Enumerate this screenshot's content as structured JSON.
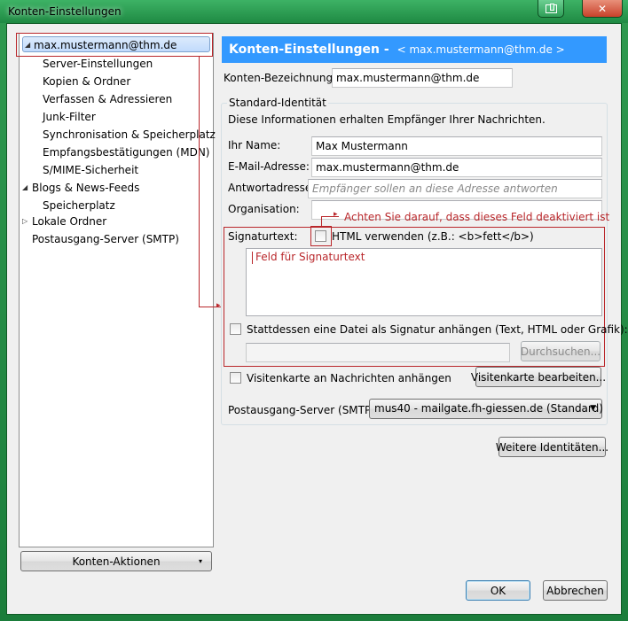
{
  "window": {
    "title": "Konten-Einstellungen"
  },
  "tree": {
    "items": [
      {
        "label": "max.mustermann@thm.de"
      },
      {
        "label": "Server-Einstellungen"
      },
      {
        "label": "Kopien & Ordner"
      },
      {
        "label": "Verfassen & Adressieren"
      },
      {
        "label": "Junk-Filter"
      },
      {
        "label": "Synchronisation & Speicherplatz"
      },
      {
        "label": "Empfangsbestätigungen (MDN)"
      },
      {
        "label": "S/MIME-Sicherheit"
      },
      {
        "label": "Blogs & News-Feeds"
      },
      {
        "label": "Speicherplatz"
      },
      {
        "label": "Lokale Ordner"
      },
      {
        "label": "Postausgang-Server (SMTP)"
      }
    ],
    "account_actions_label": "Konten-Aktionen"
  },
  "header": {
    "title": "Konten-Einstellungen",
    "subtitle": "< max.mustermann@thm.de >"
  },
  "account": {
    "name_label": "Konten-Bezeichnung:",
    "name_value": "max.mustermann@thm.de"
  },
  "identity": {
    "group_title": "Standard-Identität",
    "description": "Diese Informationen erhalten Empfänger Ihrer Nachrichten.",
    "name_label": "Ihr Name:",
    "name_value": "Max Mustermann",
    "email_label": "E-Mail-Adresse:",
    "email_value": "max.mustermann@thm.de",
    "reply_label": "Antwortadresse:",
    "reply_placeholder": "Empfänger sollen an diese Adresse antworten",
    "org_label": "Organisation:",
    "org_value": "",
    "signature_label": "Signaturtext:",
    "html_checkbox_label": "HTML verwenden (z.B.: <b>fett</b>)",
    "attach_file_label": "Stattdessen eine Datei als Signatur anhängen (Text, HTML oder Grafik):",
    "browse_label": "Durchsuchen...",
    "vcard_label": "Visitenkarte an Nachrichten anhängen",
    "vcard_edit_label": "Visitenkarte bearbeiten...",
    "smtp_label": "Postausgang-Server (SMTP):",
    "smtp_value": "mus40 - mailgate.fh-giessen.de (Standard)",
    "more_identities_label": "Weitere Identitäten..."
  },
  "annotations": {
    "html_warning": "Achten Sie darauf, dass dieses Feld deaktiviert ist",
    "signature_field": "Feld für Signaturtext",
    "color": "#b9272b"
  },
  "footer": {
    "ok_label": "OK",
    "cancel_label": "Abbrechen"
  }
}
